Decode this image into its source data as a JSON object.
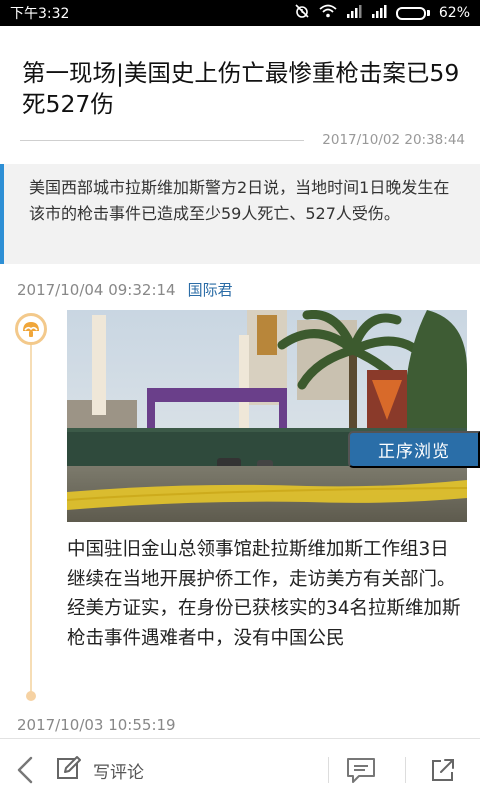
{
  "status_bar": {
    "time": "下午3:32",
    "battery_percent_label": "62%",
    "battery_level": 0.62,
    "icons": [
      "alarm-muted-icon",
      "wifi-icon",
      "signal-icon",
      "signal-icon",
      "battery-icon"
    ]
  },
  "article": {
    "title": "第一现场|美国史上伤亡最惨重枪击案已59死527伤",
    "timestamp": "2017/10/02 20:38:44",
    "summary": "美国西部城市拉斯维加斯警方2日说，当地时间1日晚发生在该市的枪击事件已造成至少59人死亡、527人受伤。"
  },
  "entries": [
    {
      "time": "2017/10/04 09:32:14",
      "author": "国际君",
      "badge_icon": "news-badge-icon",
      "text": "中国驻旧金山总领事馆赴拉斯维加斯工作组3日继续在当地开展护侨工作，走访美方有关部门。经美方证实，在身份已获核实的34名拉斯维加斯枪击事件遇难者中，没有中国公民"
    },
    {
      "time": "2017/10/03 10:55:19"
    }
  ],
  "order_button": {
    "label": "正序浏览"
  },
  "toolbar": {
    "back_icon": "chevron-left-icon",
    "write_icon": "pencil-icon",
    "write_label": "写评论",
    "comment_icon": "comment-icon",
    "share_icon": "share-icon"
  },
  "colors": {
    "accent": "#2d8fd5",
    "button": "#2a6ea8",
    "author_link": "#2b6ca6",
    "timeline": "#f3c98b"
  }
}
